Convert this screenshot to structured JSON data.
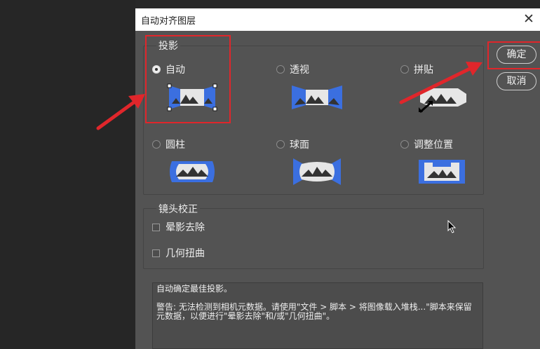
{
  "dialog": {
    "title": "自动对齐图层",
    "close_symbol": "✕"
  },
  "projection": {
    "legend": "投影",
    "options": [
      {
        "label": "自动",
        "selected": true,
        "icon": "auto-layout-icon"
      },
      {
        "label": "透视",
        "selected": false,
        "icon": "perspective-layout-icon"
      },
      {
        "label": "拼贴",
        "selected": false,
        "icon": "collage-layout-icon"
      },
      {
        "label": "圆柱",
        "selected": false,
        "icon": "cylindrical-layout-icon"
      },
      {
        "label": "球面",
        "selected": false,
        "icon": "spherical-layout-icon"
      },
      {
        "label": "调整位置",
        "selected": false,
        "icon": "reposition-layout-icon"
      }
    ]
  },
  "lens": {
    "legend": "镜头校正",
    "options": [
      {
        "label": "晕影去除",
        "checked": false
      },
      {
        "label": "几何扭曲",
        "checked": false
      }
    ]
  },
  "buttons": {
    "ok": "确定",
    "cancel": "取消"
  },
  "description": {
    "line1": "自动确定最佳投影。",
    "line2": "警告: 无法检测到相机元数据。请使用\"文件 > 脚本 > 将图像载入堆栈...\"脚本来保留元数据，以便进行\"晕影去除\"和/或\"几何扭曲\"。"
  },
  "colors": {
    "accent_blue": "#3b6fe0",
    "annotation_red": "#e0262b",
    "dialog_bg": "#535353"
  }
}
